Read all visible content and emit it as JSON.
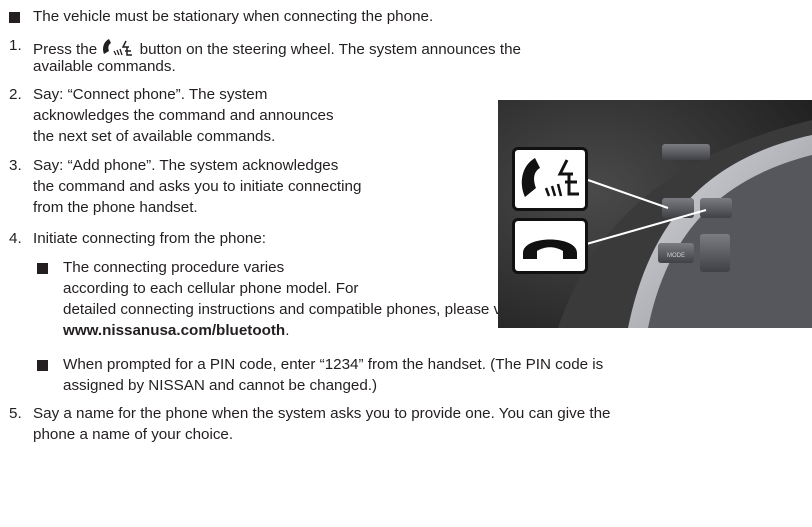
{
  "intro_bullet": "The vehicle must be stationary when connecting the phone.",
  "steps": [
    {
      "number": "1.",
      "lines": [
        "Press the",
        "button on the steering wheel. The system announces the",
        "available commands."
      ]
    },
    {
      "number": "2.",
      "lines": [
        "Say: “Connect phone”. The system",
        "acknowledges the command and announces",
        "the next set of available commands."
      ]
    },
    {
      "number": "3.",
      "lines": [
        "Say: “Add phone”. The system acknowledges",
        "the command and asks you to initiate connecting",
        "from the phone handset."
      ]
    },
    {
      "number": "4.",
      "lines": [
        "Initiate connecting from the phone:"
      ]
    },
    {
      "number": "5.",
      "lines": [
        "Say a name for the phone when the system asks you to provide one. You can give the",
        "phone a name of your choice."
      ]
    }
  ],
  "sub_bullets": [
    {
      "lines": [
        "The connecting procedure varies",
        "according to each cellular phone model. For",
        "detailed connecting instructions and compatible phones, please visit"
      ],
      "link": "www.nissanusa.com/bluetooth",
      "link_suffix": "."
    },
    {
      "lines": [
        "When prompted for a PIN code, enter “1234” from the handset. (The PIN code is",
        "assigned by NISSAN and cannot be changed.)"
      ]
    }
  ],
  "photo_button_labels": {
    "mode": "MODE"
  },
  "icons": [
    "talk-button-icon",
    "phone-hangup-icon"
  ],
  "colors": {
    "text": "#231f20",
    "photo_bg": "#2b2b2b"
  }
}
